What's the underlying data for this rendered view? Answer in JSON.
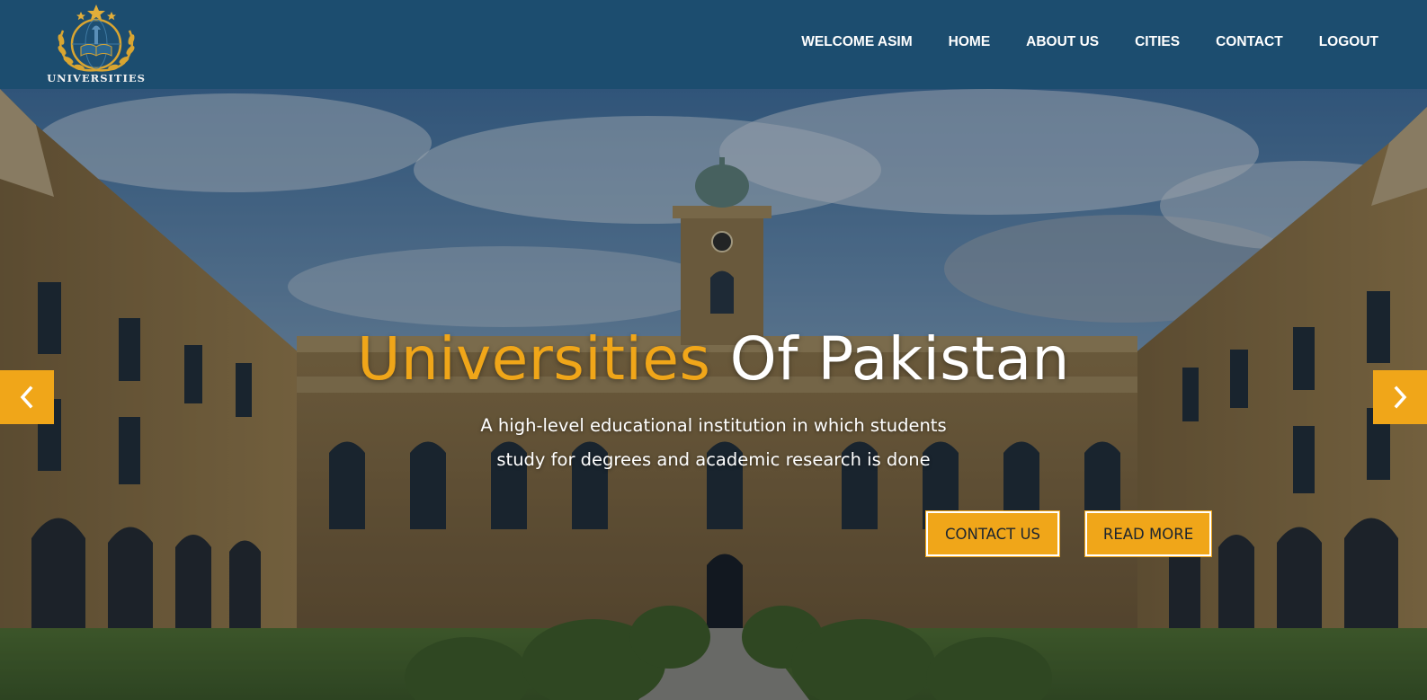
{
  "logo": {
    "text": "UNIVERSITIES",
    "icon": "university-emblem-icon"
  },
  "nav": {
    "items": [
      {
        "label": "WELCOME ASIM"
      },
      {
        "label": "HOME"
      },
      {
        "label": "ABOUT US"
      },
      {
        "label": "CITIES"
      },
      {
        "label": "CONTACT"
      },
      {
        "label": "LOGOUT"
      }
    ]
  },
  "hero": {
    "title_accent": "Universities",
    "title_rest": " Of Pakistan",
    "subtitle_line1": "A high-level educational institution in which students",
    "subtitle_line2": "study for degrees and academic research is done",
    "contact_button": "CONTACT US",
    "read_more_button": "READ MORE",
    "prev_icon": "chevron-left-icon",
    "next_icon": "chevron-right-icon"
  },
  "colors": {
    "header_bg": "#1c4d6f",
    "accent": "#f0a619",
    "text_light": "#ffffff"
  }
}
